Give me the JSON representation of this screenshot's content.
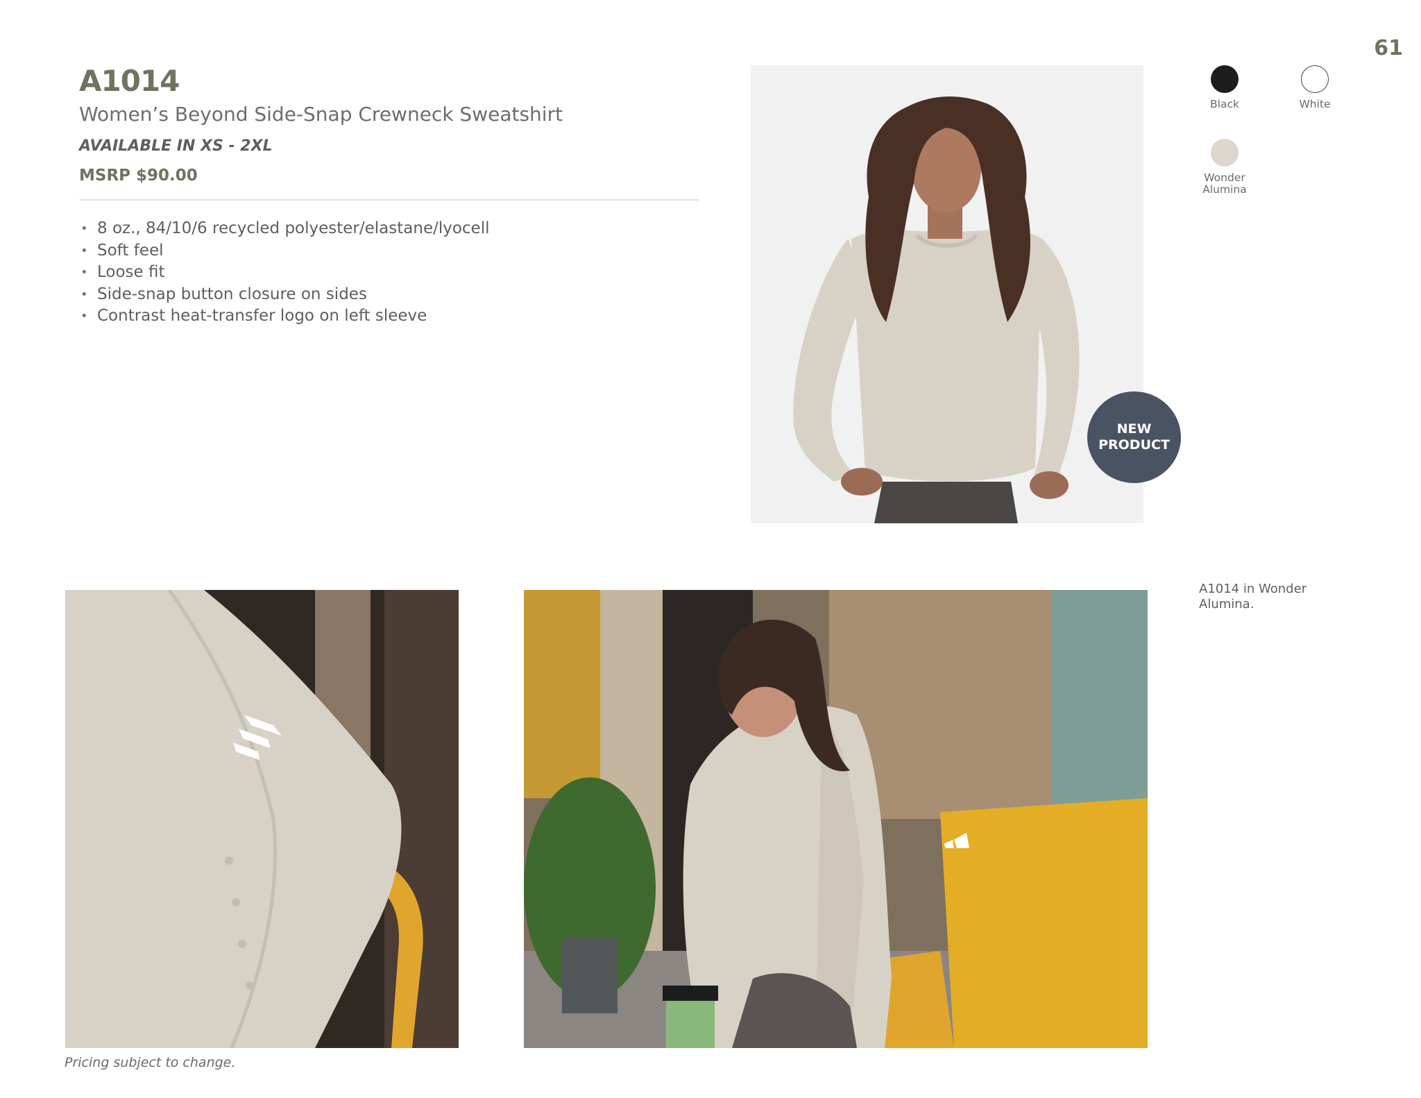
{
  "page": {
    "number": "61"
  },
  "product": {
    "style_code": "A1014",
    "name": "Women’s Beyond Side-Snap Crewneck Sweatshirt",
    "sizes": "AVAILABLE IN XS - 2XL",
    "msrp": "MSRP $90.00",
    "features": [
      "8 oz., 84/10/6 recycled polyester/elastane/lyocell",
      "Soft feel",
      "Loose fit",
      "Side-snap button closure on sides",
      "Contrast heat-transfer logo on left sleeve"
    ]
  },
  "colors": [
    {
      "label": "Black",
      "hex": "#1e1c1d"
    },
    {
      "label": "White",
      "hex": "#ffffff"
    },
    {
      "label_line1": "Wonder",
      "label_line2": "Alumina",
      "hex": "#ddd6cb"
    }
  ],
  "badge": {
    "line1": "NEW",
    "line2": "PRODUCT"
  },
  "caption": "A1014 in Wonder Alumina.",
  "disclaimer": "Pricing subject to change.",
  "theme": {
    "accent": "#6f7360",
    "badge": "#4a5363",
    "sweatshirt": "#d8d1c6"
  },
  "images": {
    "main": "model-front-photo",
    "detail": "sleeve-logo-detail-photo",
    "lifestyle": "model-seated-cafe-photo"
  }
}
